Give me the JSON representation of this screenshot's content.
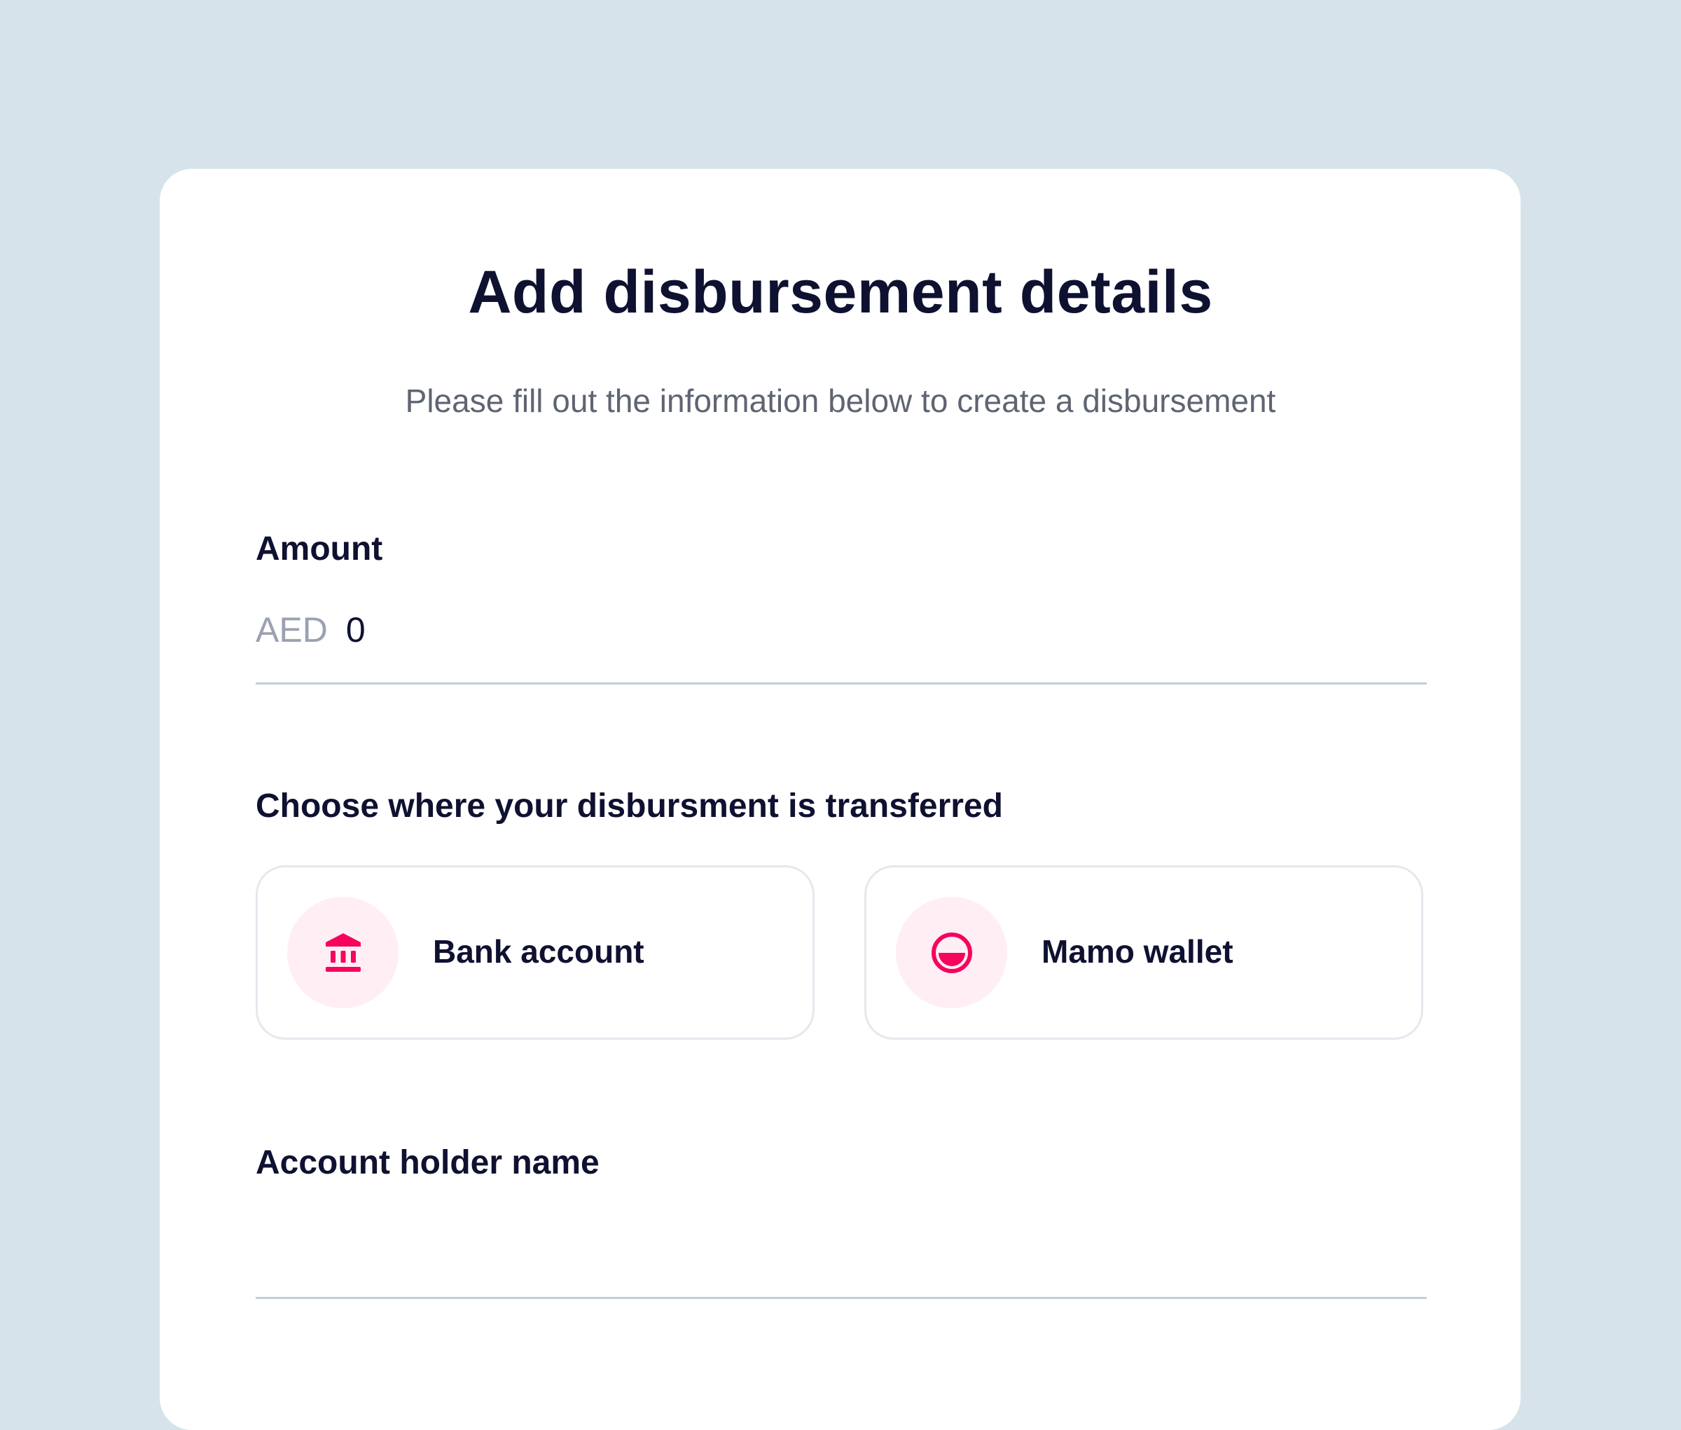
{
  "form": {
    "title": "Add disbursement details",
    "subtitle": "Please fill out the information below to create a disbursement",
    "amount": {
      "label": "Amount",
      "currency": "AED",
      "value": "0"
    },
    "destination": {
      "label": "Choose where your disbursment is transferred",
      "options": [
        {
          "label": "Bank account",
          "icon": "bank-icon"
        },
        {
          "label": "Mamo wallet",
          "icon": "wallet-icon"
        }
      ]
    },
    "account_holder": {
      "label": "Account holder name",
      "value": ""
    }
  },
  "colors": {
    "background": "#d7e3eb",
    "card": "#ffffff",
    "text": "#0f1131",
    "muted": "#5e6472",
    "accent": "#f5055d",
    "icon_bg": "#ffeef4"
  }
}
